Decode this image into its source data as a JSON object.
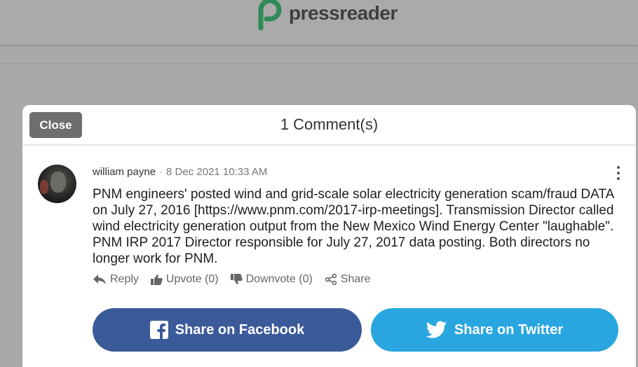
{
  "header": {
    "brand": "pressreader",
    "brand_color": "#2e8b57"
  },
  "modal": {
    "close_label": "Close",
    "title": "1 Comment(s)"
  },
  "comment": {
    "author": "william payne",
    "separator": "·",
    "date": "8 Dec 2021 10:33 AM",
    "text": "PNM engineers' posted wind and grid-scale solar electricity generation scam/fraud DATA on July 27, 2016 [https://www.pnm.com/2017-irp-meetings]. Transmission Director called wind electricity generation output from the New Mexico Wind Energy Center \"laughable\". PNM IRP 2017 Director responsible for July 27, 2017 data posting. Both directors no longer work for PNM.",
    "actions": {
      "reply": "Reply",
      "upvote": "Upvote",
      "upvote_count": "(0)",
      "downvote": "Downvote",
      "downvote_count": "(0)",
      "share": "Share"
    }
  },
  "share": {
    "facebook_label": "Share on Facebook",
    "facebook_color": "#3b5a9a",
    "twitter_label": "Share on Twitter",
    "twitter_color": "#29a6e0"
  },
  "icons": [
    "pressreader-logo-icon",
    "kebab-menu-icon",
    "reply-icon",
    "thumbs-up-icon",
    "thumbs-down-icon",
    "share-icon",
    "facebook-icon",
    "twitter-icon"
  ]
}
